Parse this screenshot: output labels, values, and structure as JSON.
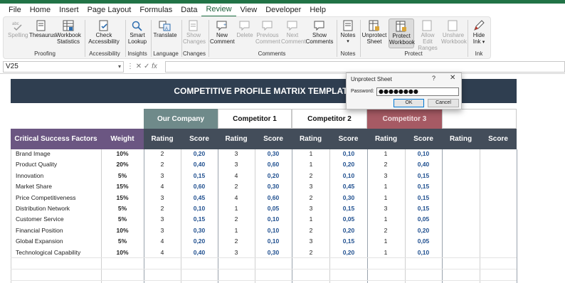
{
  "menu": {
    "tabs": [
      "File",
      "Home",
      "Insert",
      "Page Layout",
      "Formulas",
      "Data",
      "Review",
      "View",
      "Developer",
      "Help"
    ],
    "active": "Review"
  },
  "ribbon": {
    "spelling": "Spelling",
    "thesaurus": "Thesaurus",
    "workbook_statistics": "Workbook Statistics",
    "check_accessibility": "Check Accessibility",
    "smart_lookup": "Smart Lookup",
    "translate": "Translate",
    "show_changes": "Show Changes",
    "new_comment": "New Comment",
    "delete": "Delete",
    "previous_comment": "Previous Comment",
    "next_comment": "Next Comment",
    "show_comments": "Show Comments",
    "notes": "Notes",
    "unprotect_sheet": "Unprotect Sheet",
    "protect_workbook": "Protect Workbook",
    "allow_edit_ranges": "Allow Edit Ranges",
    "unshare_workbook": "Unshare Workbook",
    "hide_ink": "Hide Ink",
    "groups": {
      "proofing": "Proofing",
      "accessibility": "Accessibility",
      "insights": "Insights",
      "language": "Language",
      "changes": "Changes",
      "comments": "Comments",
      "notes": "Notes",
      "protect": "Protect",
      "ink": "Ink"
    }
  },
  "formula_bar": {
    "cell_ref": "V25",
    "fx": "fx",
    "formula": ""
  },
  "sheet": {
    "title": "COMPETITIVE PROFILE MATRIX TEMPLATE",
    "companies": [
      "Our Company",
      "Competitor 1",
      "Competitor 2",
      "Competitor 3"
    ],
    "headers": {
      "factor": "Critical Success Factors",
      "weight": "Weight",
      "rating": "Rating",
      "score": "Score"
    },
    "rows": [
      {
        "factor": "Brand Image",
        "weight": "10%",
        "r": [
          "2",
          "3",
          "1",
          "1"
        ],
        "s": [
          "0,20",
          "0,30",
          "0,10",
          "0,10"
        ]
      },
      {
        "factor": "Product Quality",
        "weight": "20%",
        "r": [
          "2",
          "3",
          "1",
          "2"
        ],
        "s": [
          "0,40",
          "0,60",
          "0,20",
          "0,40"
        ]
      },
      {
        "factor": "Innovation",
        "weight": "5%",
        "r": [
          "3",
          "4",
          "2",
          "3"
        ],
        "s": [
          "0,15",
          "0,20",
          "0,10",
          "0,15"
        ]
      },
      {
        "factor": "Market Share",
        "weight": "15%",
        "r": [
          "4",
          "2",
          "3",
          "1"
        ],
        "s": [
          "0,60",
          "0,30",
          "0,45",
          "0,15"
        ]
      },
      {
        "factor": "Price Competitiveness",
        "weight": "15%",
        "r": [
          "3",
          "4",
          "2",
          "1"
        ],
        "s": [
          "0,45",
          "0,60",
          "0,30",
          "0,15"
        ]
      },
      {
        "factor": "Distribution Network",
        "weight": "5%",
        "r": [
          "2",
          "1",
          "3",
          "3"
        ],
        "s": [
          "0,10",
          "0,05",
          "0,15",
          "0,15"
        ]
      },
      {
        "factor": "Customer Service",
        "weight": "5%",
        "r": [
          "3",
          "2",
          "1",
          "1"
        ],
        "s": [
          "0,15",
          "0,10",
          "0,05",
          "0,05"
        ]
      },
      {
        "factor": "Financial Position",
        "weight": "10%",
        "r": [
          "3",
          "1",
          "2",
          "2"
        ],
        "s": [
          "0,30",
          "0,10",
          "0,20",
          "0,20"
        ]
      },
      {
        "factor": "Global Expansion",
        "weight": "5%",
        "r": [
          "4",
          "2",
          "3",
          "1"
        ],
        "s": [
          "0,20",
          "0,10",
          "0,15",
          "0,05"
        ]
      },
      {
        "factor": "Technological Capability",
        "weight": "10%",
        "r": [
          "4",
          "3",
          "2",
          "1"
        ],
        "s": [
          "0,40",
          "0,30",
          "0,20",
          "0,10"
        ]
      }
    ],
    "colors": {
      "title_bg": "#2f3e50",
      "header_bg": "#434d5a",
      "factor_header_bg": "#6b5682",
      "our_company_bg": "#6f8a8a",
      "competitor3_bg": "#a65a64",
      "score_text": "#1f4f8f"
    }
  },
  "dialog": {
    "title": "Unprotect Sheet",
    "help": "?",
    "close": "✕",
    "password_label": "Password:",
    "password_value": "●●●●●●●●",
    "ok": "OK",
    "cancel": "Cancel"
  }
}
